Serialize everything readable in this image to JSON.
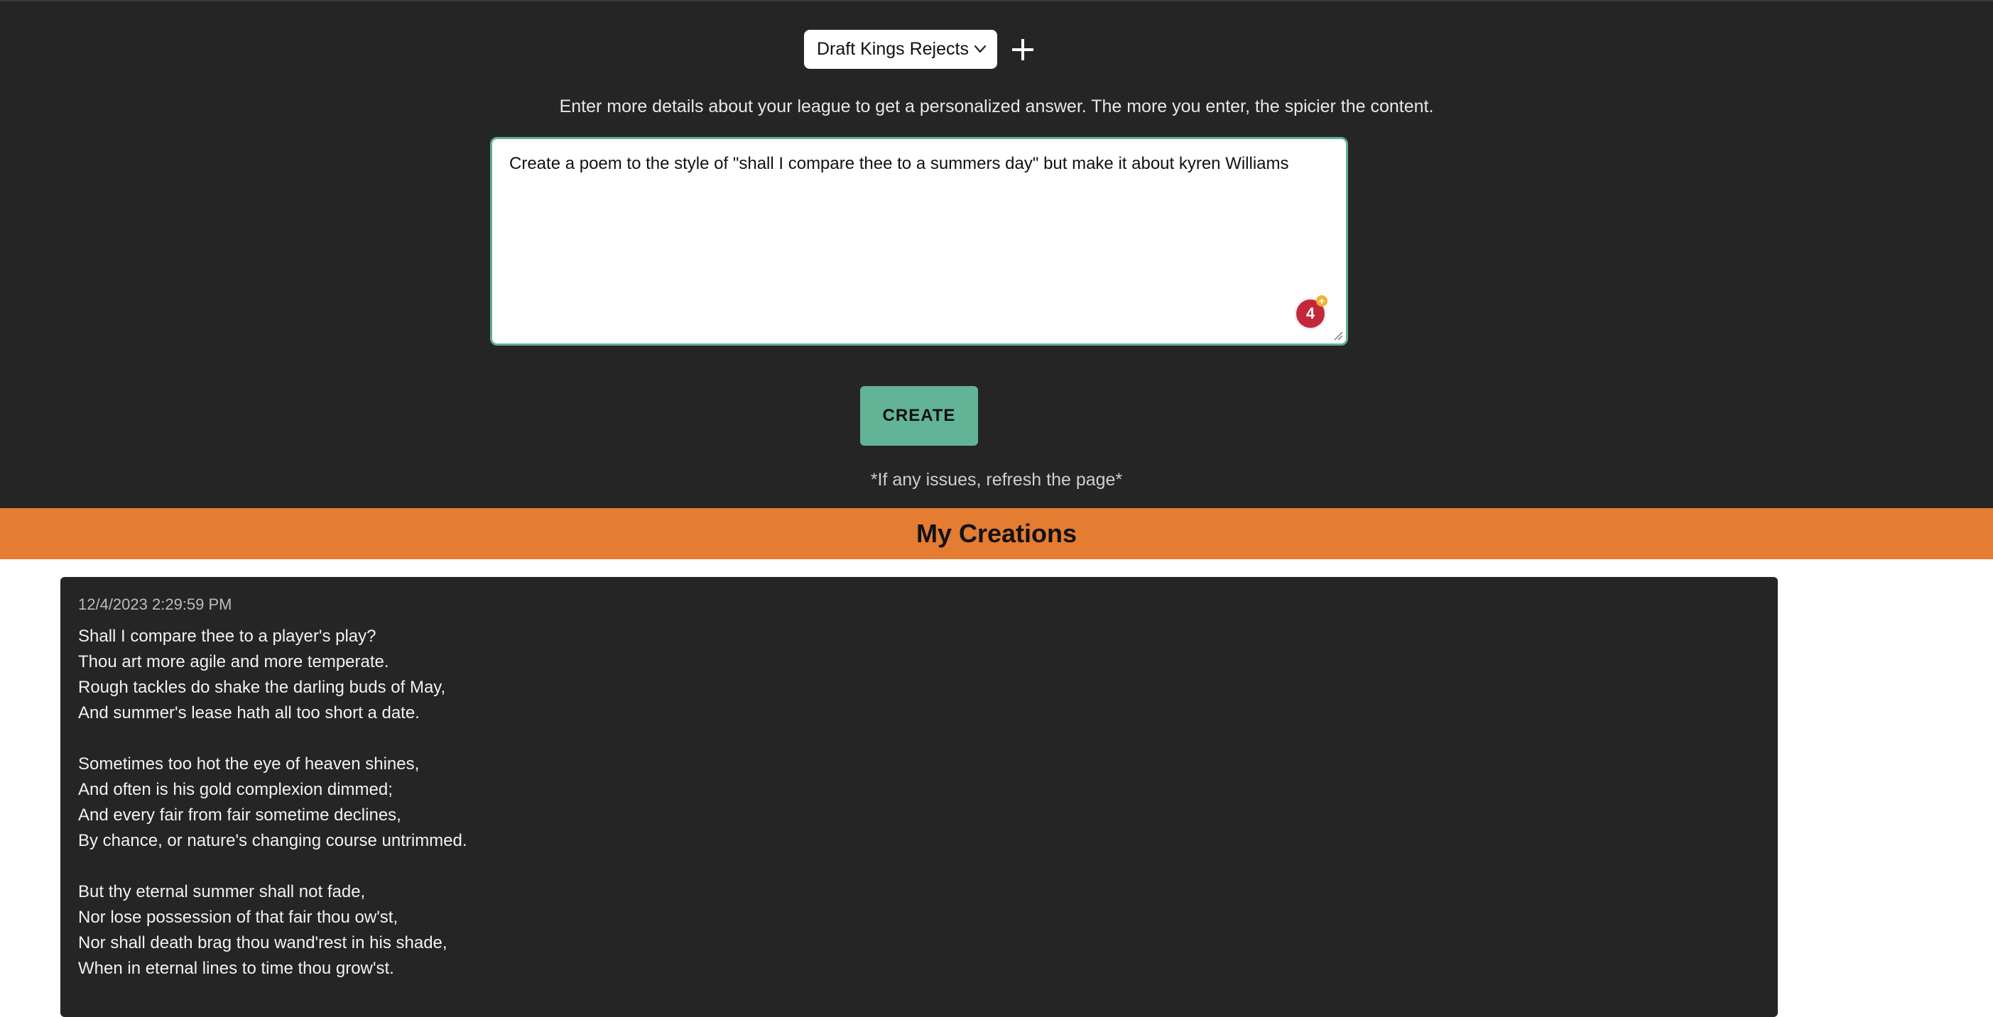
{
  "header": {
    "league_selected": "Draft Kings Rejects",
    "add_icon": "plus-icon",
    "intro_text": "Enter more details about your league to get a personalized answer. The more you enter, the spicier the content."
  },
  "prompt": {
    "value": "Create a poem to the style of \"shall I compare thee to a summers day\" but make it about kyren Williams",
    "grammar_count": "4",
    "grammar_plus": "+"
  },
  "actions": {
    "create_label": "CREATE",
    "note": "*If any issues, refresh the page*"
  },
  "creations": {
    "title": "My Creations",
    "items": [
      {
        "timestamp": "12/4/2023 2:29:59 PM",
        "stanzas": [
          [
            "Shall I compare thee to a player's play?",
            "Thou art more agile and more temperate.",
            "Rough tackles do shake the darling buds of May,",
            "And summer's lease hath all too short a date."
          ],
          [
            "Sometimes too hot the eye of heaven shines,",
            "And often is his gold complexion dimmed;",
            "And every fair from fair sometime declines,",
            "By chance, or nature's changing course untrimmed."
          ],
          [
            "But thy eternal summer shall not fade,",
            "Nor lose possession of that fair thou ow'st,",
            "Nor shall death brag thou wand'rest in his shade,",
            "When in eternal lines to time thou grow'st."
          ]
        ]
      }
    ]
  },
  "colors": {
    "dark_bg": "#252525",
    "accent_green": "#63b397",
    "orange_bar": "#e47c32",
    "badge_red": "#c2283a"
  }
}
